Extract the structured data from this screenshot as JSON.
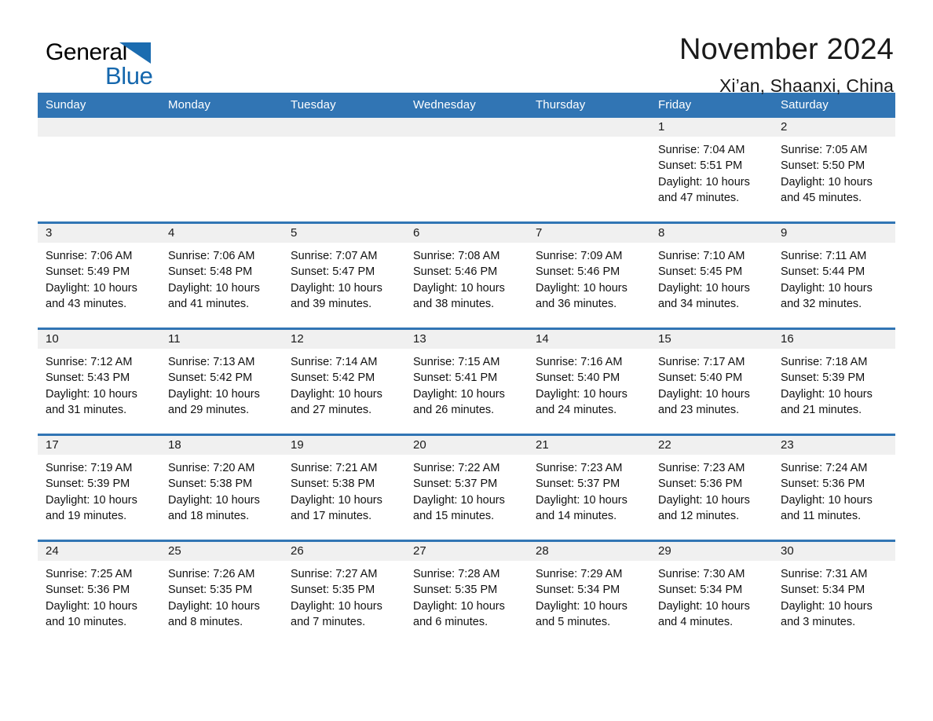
{
  "brand": {
    "name_part1": "General",
    "name_part2": "Blue",
    "accent_color": "#1567ad",
    "triangle_color": "#1b6cb0"
  },
  "header": {
    "title": "November 2024",
    "subtitle": "Xi’an, Shaanxi, China"
  },
  "theme": {
    "header_blue": "#3175b4",
    "daynum_gray": "#f0f0f0"
  },
  "weekdays": [
    "Sunday",
    "Monday",
    "Tuesday",
    "Wednesday",
    "Thursday",
    "Friday",
    "Saturday"
  ],
  "weeks": [
    [
      {
        "day": "",
        "lines": []
      },
      {
        "day": "",
        "lines": []
      },
      {
        "day": "",
        "lines": []
      },
      {
        "day": "",
        "lines": []
      },
      {
        "day": "",
        "lines": []
      },
      {
        "day": "1",
        "lines": [
          "Sunrise: 7:04 AM",
          "Sunset: 5:51 PM",
          "Daylight: 10 hours",
          "and 47 minutes."
        ]
      },
      {
        "day": "2",
        "lines": [
          "Sunrise: 7:05 AM",
          "Sunset: 5:50 PM",
          "Daylight: 10 hours",
          "and 45 minutes."
        ]
      }
    ],
    [
      {
        "day": "3",
        "lines": [
          "Sunrise: 7:06 AM",
          "Sunset: 5:49 PM",
          "Daylight: 10 hours",
          "and 43 minutes."
        ]
      },
      {
        "day": "4",
        "lines": [
          "Sunrise: 7:06 AM",
          "Sunset: 5:48 PM",
          "Daylight: 10 hours",
          "and 41 minutes."
        ]
      },
      {
        "day": "5",
        "lines": [
          "Sunrise: 7:07 AM",
          "Sunset: 5:47 PM",
          "Daylight: 10 hours",
          "and 39 minutes."
        ]
      },
      {
        "day": "6",
        "lines": [
          "Sunrise: 7:08 AM",
          "Sunset: 5:46 PM",
          "Daylight: 10 hours",
          "and 38 minutes."
        ]
      },
      {
        "day": "7",
        "lines": [
          "Sunrise: 7:09 AM",
          "Sunset: 5:46 PM",
          "Daylight: 10 hours",
          "and 36 minutes."
        ]
      },
      {
        "day": "8",
        "lines": [
          "Sunrise: 7:10 AM",
          "Sunset: 5:45 PM",
          "Daylight: 10 hours",
          "and 34 minutes."
        ]
      },
      {
        "day": "9",
        "lines": [
          "Sunrise: 7:11 AM",
          "Sunset: 5:44 PM",
          "Daylight: 10 hours",
          "and 32 minutes."
        ]
      }
    ],
    [
      {
        "day": "10",
        "lines": [
          "Sunrise: 7:12 AM",
          "Sunset: 5:43 PM",
          "Daylight: 10 hours",
          "and 31 minutes."
        ]
      },
      {
        "day": "11",
        "lines": [
          "Sunrise: 7:13 AM",
          "Sunset: 5:42 PM",
          "Daylight: 10 hours",
          "and 29 minutes."
        ]
      },
      {
        "day": "12",
        "lines": [
          "Sunrise: 7:14 AM",
          "Sunset: 5:42 PM",
          "Daylight: 10 hours",
          "and 27 minutes."
        ]
      },
      {
        "day": "13",
        "lines": [
          "Sunrise: 7:15 AM",
          "Sunset: 5:41 PM",
          "Daylight: 10 hours",
          "and 26 minutes."
        ]
      },
      {
        "day": "14",
        "lines": [
          "Sunrise: 7:16 AM",
          "Sunset: 5:40 PM",
          "Daylight: 10 hours",
          "and 24 minutes."
        ]
      },
      {
        "day": "15",
        "lines": [
          "Sunrise: 7:17 AM",
          "Sunset: 5:40 PM",
          "Daylight: 10 hours",
          "and 23 minutes."
        ]
      },
      {
        "day": "16",
        "lines": [
          "Sunrise: 7:18 AM",
          "Sunset: 5:39 PM",
          "Daylight: 10 hours",
          "and 21 minutes."
        ]
      }
    ],
    [
      {
        "day": "17",
        "lines": [
          "Sunrise: 7:19 AM",
          "Sunset: 5:39 PM",
          "Daylight: 10 hours",
          "and 19 minutes."
        ]
      },
      {
        "day": "18",
        "lines": [
          "Sunrise: 7:20 AM",
          "Sunset: 5:38 PM",
          "Daylight: 10 hours",
          "and 18 minutes."
        ]
      },
      {
        "day": "19",
        "lines": [
          "Sunrise: 7:21 AM",
          "Sunset: 5:38 PM",
          "Daylight: 10 hours",
          "and 17 minutes."
        ]
      },
      {
        "day": "20",
        "lines": [
          "Sunrise: 7:22 AM",
          "Sunset: 5:37 PM",
          "Daylight: 10 hours",
          "and 15 minutes."
        ]
      },
      {
        "day": "21",
        "lines": [
          "Sunrise: 7:23 AM",
          "Sunset: 5:37 PM",
          "Daylight: 10 hours",
          "and 14 minutes."
        ]
      },
      {
        "day": "22",
        "lines": [
          "Sunrise: 7:23 AM",
          "Sunset: 5:36 PM",
          "Daylight: 10 hours",
          "and 12 minutes."
        ]
      },
      {
        "day": "23",
        "lines": [
          "Sunrise: 7:24 AM",
          "Sunset: 5:36 PM",
          "Daylight: 10 hours",
          "and 11 minutes."
        ]
      }
    ],
    [
      {
        "day": "24",
        "lines": [
          "Sunrise: 7:25 AM",
          "Sunset: 5:36 PM",
          "Daylight: 10 hours",
          "and 10 minutes."
        ]
      },
      {
        "day": "25",
        "lines": [
          "Sunrise: 7:26 AM",
          "Sunset: 5:35 PM",
          "Daylight: 10 hours",
          "and 8 minutes."
        ]
      },
      {
        "day": "26",
        "lines": [
          "Sunrise: 7:27 AM",
          "Sunset: 5:35 PM",
          "Daylight: 10 hours",
          "and 7 minutes."
        ]
      },
      {
        "day": "27",
        "lines": [
          "Sunrise: 7:28 AM",
          "Sunset: 5:35 PM",
          "Daylight: 10 hours",
          "and 6 minutes."
        ]
      },
      {
        "day": "28",
        "lines": [
          "Sunrise: 7:29 AM",
          "Sunset: 5:34 PM",
          "Daylight: 10 hours",
          "and 5 minutes."
        ]
      },
      {
        "day": "29",
        "lines": [
          "Sunrise: 7:30 AM",
          "Sunset: 5:34 PM",
          "Daylight: 10 hours",
          "and 4 minutes."
        ]
      },
      {
        "day": "30",
        "lines": [
          "Sunrise: 7:31 AM",
          "Sunset: 5:34 PM",
          "Daylight: 10 hours",
          "and 3 minutes."
        ]
      }
    ]
  ]
}
